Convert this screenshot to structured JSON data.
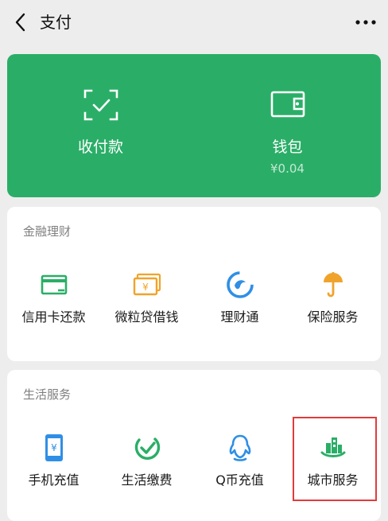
{
  "header": {
    "title": "支付",
    "back_icon": "chevron-left-icon",
    "more_icon": "more-horizontal-icon"
  },
  "pay_card": {
    "background": "#2aae67",
    "collect": {
      "label": "收付款",
      "icon": "scan-code-icon"
    },
    "wallet": {
      "label": "钱包",
      "balance": "¥0.04",
      "icon": "wallet-icon"
    }
  },
  "finance": {
    "title": "金融理财",
    "items": [
      {
        "label": "信用卡还款",
        "icon": "credit-card-icon"
      },
      {
        "label": "微粒贷借钱",
        "icon": "yuan-bill-icon"
      },
      {
        "label": "理财通",
        "icon": "licaitong-icon"
      },
      {
        "label": "保险服务",
        "icon": "umbrella-icon"
      }
    ]
  },
  "life": {
    "title": "生活服务",
    "items": [
      {
        "label": "手机充值",
        "icon": "phone-yuan-icon"
      },
      {
        "label": "生活缴费",
        "icon": "check-circle-icon"
      },
      {
        "label": "Q币充值",
        "icon": "qq-penguin-icon"
      },
      {
        "label": "城市服务",
        "icon": "city-building-icon"
      }
    ]
  },
  "highlight_color": "#e23b3b"
}
